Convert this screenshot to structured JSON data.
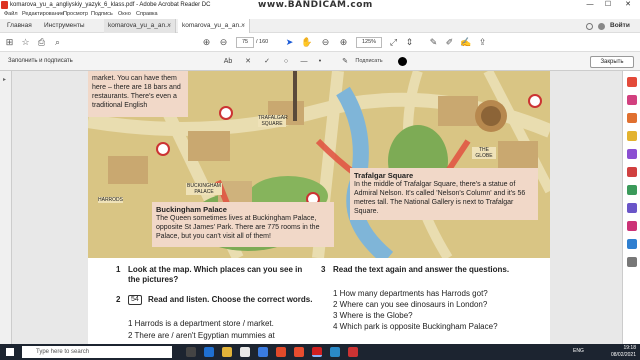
{
  "window": {
    "title": "komarova_yu_a_angliyskiy_yazyk_6_klass.pdf - Adobe Acrobat Reader DC",
    "watermark": "www.BANDICAM.com",
    "minimize": "—",
    "maximize": "☐",
    "close": "✕"
  },
  "menu": [
    "Файл",
    "Редактирование",
    "Просмотр",
    "Подпись",
    "Окно",
    "Справка"
  ],
  "tabs": {
    "home": "Главная",
    "tools": "Инструменты",
    "file1": "komarova_yu_a_an...",
    "file2": "komarova_yu_a_an...",
    "close": "×",
    "signin": "Войти"
  },
  "toolbar": {
    "page_current": "75",
    "page_total": "/ 160",
    "zoom": "125%"
  },
  "sign_toolbar": {
    "label": "Заполнить и подписать",
    "tool_text": "Ab",
    "sign_label": "Подписать",
    "close_button": "Закрыть"
  },
  "document": {
    "notes": {
      "harrods_text": "market. You can have them here – there are 18 bars and restaurants. There's even a traditional English",
      "trafalgar_title": "Trafalgar Square",
      "trafalgar_text": "In the middle of Trafalgar Square, there's a statue of Admiral Nelson. It's called 'Nelson's Column' and it's 56 metres tall. The National Gallery is next to Trafalgar Square.",
      "buckingham_title": "Buckingham Palace",
      "buckingham_text": "The Queen sometimes lives at Buckingham Palace, opposite St James' Park. There are 775 rooms in the Palace, but you can't visit all of them!"
    },
    "map_labels": {
      "trafalgar": "TRAFALGAR SQUARE",
      "globe": "THE GLOBE",
      "buckingham": "BUCKINGHAM PALACE",
      "harrods": "HARRODS"
    },
    "task1": {
      "num": "1",
      "text": "Look at the map. Which places can you see in the pictures?"
    },
    "task2": {
      "num": "2",
      "audio": "54",
      "text": "Read and listen. Choose the correct words.",
      "items": [
        "1  Harrods is a department store / market.",
        "2  There are / aren't Egyptian mummies at"
      ]
    },
    "task3": {
      "num": "3",
      "text": "Read the text again and answer the questions.",
      "items": [
        "1  How many departments has Harrods got?",
        "2  Where can you see dinosaurs in London?",
        "3  Where is the Globe?",
        "4  Which park is opposite Buckingham Palace?"
      ]
    }
  },
  "taskbar": {
    "search_placeholder": "Type here to search",
    "lang": "ENG",
    "time": "19:18",
    "date": "08/02/2021"
  }
}
